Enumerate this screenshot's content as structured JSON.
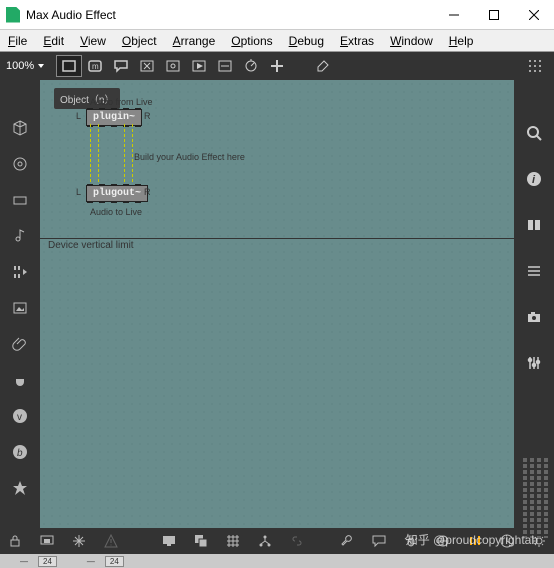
{
  "window": {
    "title": "Max Audio Effect"
  },
  "menubar": [
    "File",
    "Edit",
    "View",
    "Object",
    "Arrange",
    "Options",
    "Debug",
    "Extras",
    "Window",
    "Help"
  ],
  "zoom": "100%",
  "tooltip": "Object（n）",
  "patch": {
    "audio_from": "Audio from Live",
    "plugin": "plugin~",
    "plugout": "plugout~",
    "audio_to": "Audio to Live",
    "build_hint": "Build your Audio Effect here",
    "L": "L",
    "R": "R",
    "device_limit": "Device vertical limit"
  },
  "watermark": "知乎 @proudcopyrightab",
  "extra": {
    "v1": "24",
    "v2": "24"
  }
}
